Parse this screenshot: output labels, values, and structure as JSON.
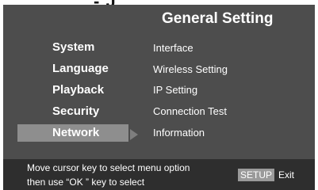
{
  "top_fragment": "- J",
  "title": "General Setting",
  "menu": [
    {
      "label": "System"
    },
    {
      "label": "Language"
    },
    {
      "label": "Playback"
    },
    {
      "label": "Security"
    },
    {
      "label": "Network",
      "selected": true
    }
  ],
  "submenu": [
    {
      "label": "Interface"
    },
    {
      "label": "Wireless Setting"
    },
    {
      "label": "IP Setting"
    },
    {
      "label": "Connection Test"
    },
    {
      "label": "Information"
    }
  ],
  "footer": {
    "hint_line1": "Move cursor key to select menu option",
    "hint_line2": "then use “OK ” key to select",
    "setup_key": "SETUP",
    "exit_label": "Exit"
  },
  "icons": {
    "selection_arrow": "right-triangle-icon"
  },
  "colors": {
    "panel_bg": "#4d4d4d",
    "selected_bg": "#8e8e8e",
    "footer_bg": "#2e2e2e",
    "text": "#ffffff"
  }
}
